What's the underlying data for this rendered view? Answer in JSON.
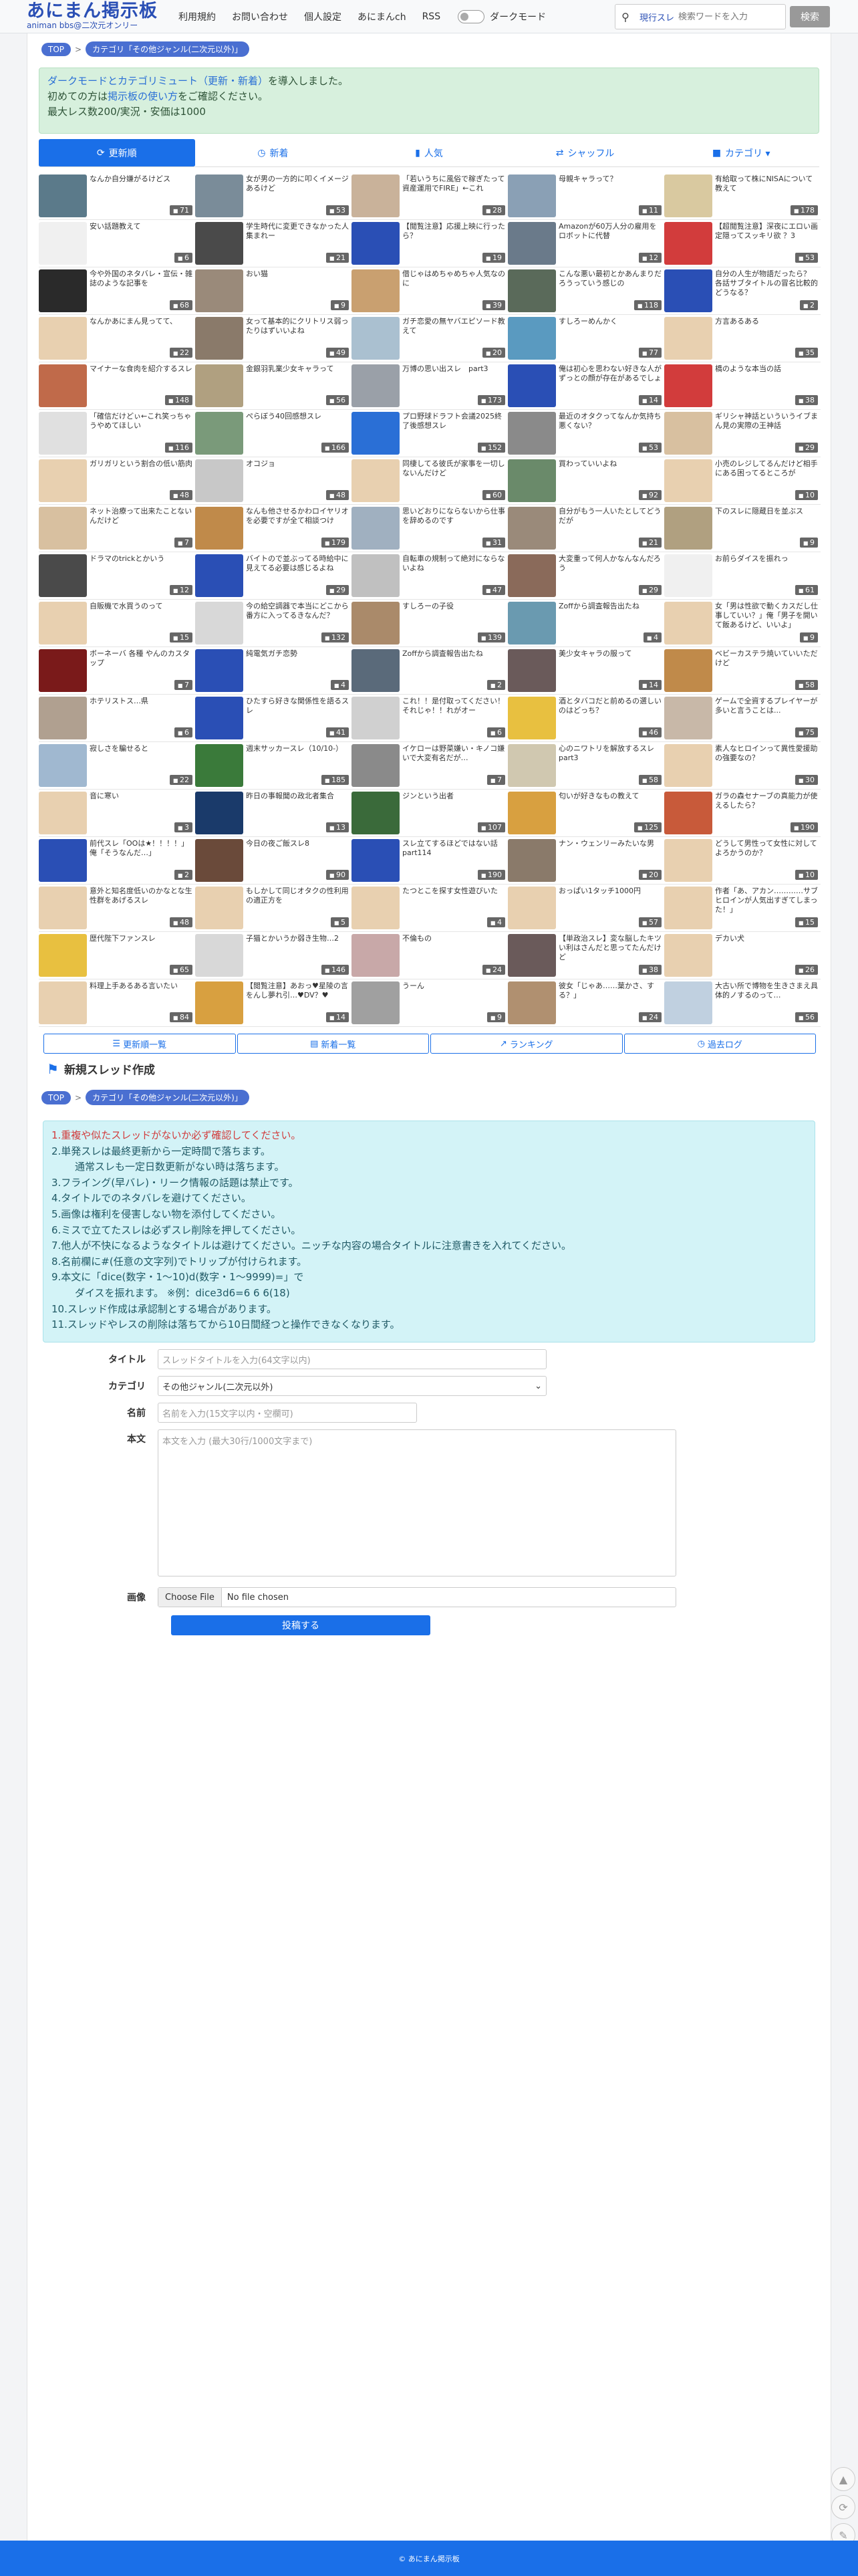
{
  "header": {
    "logo_title": "あにまん掲示板",
    "logo_sub": "animan bbs@二次元オンリー",
    "nav": [
      "利用規約",
      "お問い合わせ",
      "個人設定",
      "あにまんch",
      "RSS"
    ],
    "dark_mode_label": "ダークモード",
    "search_category": "現行スレ",
    "search_placeholder": "検索ワードを入力",
    "search_button": "検索"
  },
  "breadcrumb_top": {
    "top": "TOP",
    "category": "カテゴリ「その他ジャンル(二次元以外)」"
  },
  "notice": {
    "line1_link": "ダークモードとカテゴリミュート（更新・新着）",
    "line1_rest": "を導入しました。",
    "line2_pre": "初めての方は",
    "line2_link": "掲示板の使い方",
    "line2_rest": "をご確認ください。",
    "line3": "最大レス数200/実況・安価は1000"
  },
  "tabs": [
    {
      "label": "更新順",
      "icon": "spinner-icon"
    },
    {
      "label": "新着",
      "icon": "clock-icon"
    },
    {
      "label": "人気",
      "icon": "bar-chart-icon"
    },
    {
      "label": "シャッフル",
      "icon": "shuffle-icon"
    },
    {
      "label": "カテゴリ ▾",
      "icon": "folder-icon"
    }
  ],
  "threads": [
    {
      "t": "なんか自分嫌がるけどス",
      "c": "71",
      "col": "#5b7a8a"
    },
    {
      "t": "女が男の一方的に叩くイメージあるけど",
      "c": "53",
      "col": "#7a8c99"
    },
    {
      "t": "「若いうちに風俗で稼ぎたって資産運用でFIRE」←これ",
      "c": "28",
      "col": "#c9b29a"
    },
    {
      "t": "母親キャラって？",
      "c": "11",
      "col": "#8aa0b5"
    },
    {
      "t": "有給取って株にNISAについて教えて",
      "c": "178",
      "col": "#d9c9a0"
    },
    {
      "t": "安い話題教えて",
      "c": "6",
      "col": "#f0f0f0"
    },
    {
      "t": "学生時代に変更できなかった人集まれー",
      "c": "21",
      "col": "#4a4a4a"
    },
    {
      "t": "【閲覧注意】応援上映に行ったら？",
      "c": "19",
      "col": "#2a4fb5"
    },
    {
      "t": "Amazonが60万人分の雇用をロボットに代替",
      "c": "12",
      "col": "#6a7a8a"
    },
    {
      "t": "【超閲覧注意】深夜にエロい画定隠ってスッキリ欲 ？3",
      "c": "53",
      "col": "#d23c3c"
    },
    {
      "t": "今や外国のネタバレ・宣伝・雑誌のような記事を",
      "c": "68",
      "col": "#2a2a2a"
    },
    {
      "t": "おい猫",
      "c": "9",
      "col": "#9a8a7a"
    },
    {
      "t": "借じゃはめちゃめちゃ人気なのに",
      "c": "39",
      "col": "#c9a070"
    },
    {
      "t": "こんな悪い最初とかあんまりだろうっていう感じの",
      "c": "118",
      "col": "#5a6a5a"
    },
    {
      "t": "自分の人生が物語だったら？  各話サブタイトルの冒名比較的どうなる？",
      "c": "2",
      "col": "#2a4fb5"
    },
    {
      "t": "なんかあにまん見ってて、",
      "c": "22",
      "col": "#e8d0b0"
    },
    {
      "t": "女って基本的にクリトリス弱ったりはずいいよね",
      "c": "49",
      "col": "#8a7a6a"
    },
    {
      "t": "ガチ恋愛の無ヤバエピソード教えて",
      "c": "20",
      "col": "#aac0d0"
    },
    {
      "t": "すしろーめんかく",
      "c": "77",
      "col": "#5a9ac0"
    },
    {
      "t": "方言あるある",
      "c": "35",
      "col": "#e8d0b0"
    },
    {
      "t": "マイナーな食肉を紹介するスレ",
      "c": "148",
      "col": "#c06a4a"
    },
    {
      "t": "金銀羽乳業少女キャラって",
      "c": "56",
      "col": "#b0a080"
    },
    {
      "t": "万博の思い出スレ　part3",
      "c": "173",
      "col": "#9aa0a8"
    },
    {
      "t": "俺は初心を思わない好きな人がずっとの顔が存在があるでしょ",
      "c": "14",
      "col": "#2a4fb5"
    },
    {
      "t": "橋のような本当の話",
      "c": "38",
      "col": "#d23c3c"
    },
    {
      "t": "「確信だけどぃ←これ笑っちゃうやめてほしい",
      "c": "116",
      "col": "#e0e0e0"
    },
    {
      "t": "ぺらぼう40回感想スレ",
      "c": "166",
      "col": "#7a9a7a"
    },
    {
      "t": "プロ野球ドラフト会議2025終了後感想スレ",
      "c": "152",
      "col": "#2a6fd6"
    },
    {
      "t": "最近のオタクってなんか気持ち悪くない？",
      "c": "53",
      "col": "#8a8a8a"
    },
    {
      "t": "ギリシャ神話といういうイブまん見の実際の王神話",
      "c": "29",
      "col": "#d8c0a0"
    },
    {
      "t": "ガリガリという割合の低い筋肉",
      "c": "48",
      "col": "#e8d0b0"
    },
    {
      "t": "オコジョ",
      "c": "48",
      "col": "#c8c8c8"
    },
    {
      "t": "同棲してる彼氏が家事を一切しないんだけど",
      "c": "60",
      "col": "#e8d0b0"
    },
    {
      "t": "買わっていいよね",
      "c": "92",
      "col": "#6a8a6a"
    },
    {
      "t": "小売のレジしてるんだけど相手にある困ってるところが",
      "c": "10",
      "col": "#e8d0b0"
    },
    {
      "t": "ネット治療って出来たことないんだけど",
      "c": "7",
      "col": "#d8c0a0"
    },
    {
      "t": "なんも他させるかわロイヤリオを必要ですが全て相談つけ",
      "c": "179",
      "col": "#c08a4a"
    },
    {
      "t": "思いどおりにならないから仕事を辞めるのです",
      "c": "31",
      "col": "#a0b0c0"
    },
    {
      "t": "自分がもう一人いたとしてどうだが",
      "c": "21",
      "col": "#9a8a7a"
    },
    {
      "t": "下のスレに隠蔵日を並ぶス",
      "c": "9",
      "col": "#b0a080"
    },
    {
      "t": "ドラマのtrickとかいう",
      "c": "12",
      "col": "#4a4a4a"
    },
    {
      "t": "バイトので並ぶってる時給中に見えてる必要は感じるよね",
      "c": "29",
      "col": "#2a4fb5"
    },
    {
      "t": "自転車の規制って絶対にならないよね",
      "c": "47",
      "col": "#c0c0c0"
    },
    {
      "t": "大変重って何人かなんなんだろう",
      "c": "29",
      "col": "#8a6a5a"
    },
    {
      "t": "お前らダイスを振れっ",
      "c": "61",
      "col": "#f0f0f0"
    },
    {
      "t": "自販機で水買うのって",
      "c": "15",
      "col": "#e8d0b0"
    },
    {
      "t": "今の給空調器で本当にどこから番方に入ってるきなんだ？",
      "c": "132",
      "col": "#d8d8d8"
    },
    {
      "t": "すしろーの子役",
      "c": "139",
      "col": "#aa8a6a"
    },
    {
      "t": "Zoffから調査報告出たね",
      "c": "4",
      "col": "#6a9ab0"
    },
    {
      "t": "女「男は性欲で動くカスだし仕事していい？」俺「男子を開いて飯あるけど、いいよ」",
      "c": "9",
      "col": "#e8d0b0"
    },
    {
      "t": "ボーネーバ 各種 やんのカスタップ",
      "c": "7",
      "col": "#7a1a1a"
    },
    {
      "t": "純電気ガチ恋勢",
      "c": "4",
      "col": "#2a4fb5"
    },
    {
      "t": "Zoffから調査報告出たね",
      "c": "2",
      "col": "#5a6a7a"
    },
    {
      "t": "美少女キャラの服って",
      "c": "14",
      "col": "#6a5a5a"
    },
    {
      "t": "ベビーカステラ焼いていいただけど",
      "c": "58",
      "col": "#c08a4a"
    },
    {
      "t": "ホテリストス…県",
      "c": "6",
      "col": "#b0a090"
    },
    {
      "t": "ひたすら好きな関係性を語るスレ",
      "c": "41",
      "col": "#2a4fb5"
    },
    {
      "t": "これ！！是付取ってください！それじゃ！！れがオー",
      "c": "6",
      "col": "#d0d0d0"
    },
    {
      "t": "酒とタバコだと前めるの選しいのはどっち？",
      "c": "46",
      "col": "#e8c040"
    },
    {
      "t": "ゲームで全資するプレイヤーが多いと言うことは...",
      "c": "75",
      "col": "#c8b8a8"
    },
    {
      "t": "寂しさを騙せると",
      "c": "22",
      "col": "#a0b8d0"
    },
    {
      "t": "週末サッカースレ（10/10-）",
      "c": "185",
      "col": "#3a7a3a"
    },
    {
      "t": "イケローは野菜嫌い・キノコ嫌いで大変有名だが…",
      "c": "7",
      "col": "#8a8a8a"
    },
    {
      "t": "心のニワトリを解放するスレpart3",
      "c": "58",
      "col": "#d0c8b0"
    },
    {
      "t": "素人なヒロインって異性愛援助の強要なの？",
      "c": "30",
      "col": "#e8d0b0"
    },
    {
      "t": "音に寒い",
      "c": "3",
      "col": "#e8d0b0"
    },
    {
      "t": "昨日の事報聞の政北者集合",
      "c": "13",
      "col": "#1a3a6a"
    },
    {
      "t": "ジンという出者",
      "c": "107",
      "col": "#3a6a3a"
    },
    {
      "t": "匂いが好きなもの教えて",
      "c": "125",
      "col": "#d8a040"
    },
    {
      "t": "ガラの森セナーブの真能力が使えるしたら？",
      "c": "190",
      "col": "#c85a3a"
    },
    {
      "t": "前代スレ「OOは★！！！！」俺「そうなんだ…」",
      "c": "2",
      "col": "#2a4fb5"
    },
    {
      "t": "今日の夜ご飯スレ8",
      "c": "90",
      "col": "#6a4a3a"
    },
    {
      "t": "スレ立てするほどではない話part114",
      "c": "190",
      "col": "#2a4fb5"
    },
    {
      "t": "ナン・ウェンリーみたいな男",
      "c": "20",
      "col": "#8a7a6a"
    },
    {
      "t": "どうして男性って女性に対してよろかうのか？",
      "c": "10",
      "col": "#e8d0b0"
    },
    {
      "t": "意外と知名度低いのかなとな生性群をあげるスレ",
      "c": "48",
      "col": "#e8d0b0"
    },
    {
      "t": "もしかして同じオタクの性利用の適正方を",
      "c": "5",
      "col": "#e8d0b0"
    },
    {
      "t": "たつとこを探す女性遊びいた",
      "c": "4",
      "col": "#e8d0b0"
    },
    {
      "t": "おっぱい1タッチ1000円",
      "c": "57",
      "col": "#e8d0b0"
    },
    {
      "t": "作者「あ、アカン…………サブヒロインが人気出すぎてしまった！」",
      "c": "15",
      "col": "#e8d0b0"
    },
    {
      "t": "歴代陛下ファンスレ",
      "c": "65",
      "col": "#e8c040"
    },
    {
      "t": "子猫とかいうか弱き生物…2",
      "c": "146",
      "col": "#d8d8d8"
    },
    {
      "t": "不倫もの",
      "c": "24",
      "col": "#c8a8a8"
    },
    {
      "t": "【単政治スレ】変な脳したキツい利はさんだと思ってたんだけど",
      "c": "38",
      "col": "#6a5a5a"
    },
    {
      "t": "デカい犬",
      "c": "26",
      "col": "#e8d0b0"
    },
    {
      "t": "料理上手あるある言いたい",
      "c": "84",
      "col": "#e8d0b0"
    },
    {
      "t": "【閲覧注意】あおっ♥星陵の言をんし夢れ引…♥DV？♥",
      "c": "14",
      "col": "#d8a040"
    },
    {
      "t": "うーん",
      "c": "9",
      "col": "#a0a0a0"
    },
    {
      "t": "彼女「じゃあ……葉かさ、する？」",
      "c": "24",
      "col": "#b09070"
    },
    {
      "t": "大古い所で博物を生きさまえ具体的ノするのって…",
      "c": "56",
      "col": "#c0d0e0"
    }
  ],
  "bottom_buttons": [
    {
      "label": "更新順一覧",
      "icon": "list-icon"
    },
    {
      "label": "新着一覧",
      "icon": "new-icon"
    },
    {
      "label": "ランキング",
      "icon": "chart-icon"
    },
    {
      "label": "過去ログ",
      "icon": "clock-icon"
    }
  ],
  "new_thread": {
    "title": "新規スレッド作成",
    "breadcrumb_top": "TOP",
    "breadcrumb_category": "カテゴリ「その他ジャンル(二次元以外)」",
    "rules": [
      "1.重複や似たスレッドがないか必ず確認してください。",
      "2.単発スレは最終更新から一定時間で落ちます。",
      "　通常スレも一定日数更新がない時は落ちます。",
      "3.フライング(早バレ)・リーク情報の話題は禁止です。",
      "4.タイトルでのネタバレを避けてください。",
      "5.画像は権利を侵害しない物を添付してください。",
      "6.ミスで立てたスレは必ずスレ削除を押してください。",
      "7.他人が不快になるようなタイトルは避けてください。ニッチな内容の場合タイトルに注意書きを入れてください。",
      "8.名前欄に#(任意の文字列)でトリップが付けられます。",
      "9.本文に「dice(数字・1〜10)d(数字・1〜9999)=」で",
      "　ダイスを振れます。 ※例：dice3d6=6 6 6(18)",
      "10.スレッド作成は承認制とする場合があります。",
      "11.スレッドやレスの削除は落ちてから10日間経つと操作できなくなります。"
    ],
    "fields": {
      "title_label": "タイトル",
      "title_ph": "スレッドタイトルを入力(64文字以内)",
      "category_label": "カテゴリ",
      "category_value": "その他ジャンル(二次元以外)",
      "name_label": "名前",
      "name_ph": "名前を入力(15文字以内・空欄可)",
      "body_label": "本文",
      "body_ph": "本文を入力 (最大30行/1000文字まで)",
      "image_label": "画像",
      "file_button": "Choose File",
      "file_status": "No file chosen",
      "submit": "投稿する"
    }
  },
  "footer": "© あにまん掲示板"
}
